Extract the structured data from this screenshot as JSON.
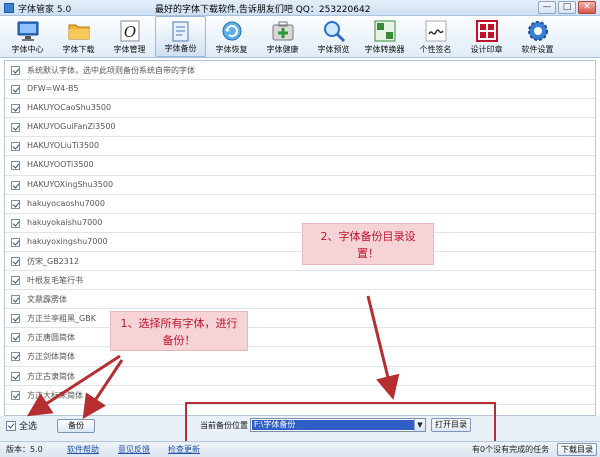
{
  "window": {
    "title": "字体管家 5.0",
    "slogan": "最好的字体下载软件,告诉朋友们吧 QQ：253220642",
    "min_label": "—",
    "max_label": "□",
    "close_label": "✕"
  },
  "toolbar": {
    "items": [
      {
        "label": "字体中心",
        "icon": "display-icon"
      },
      {
        "label": "字体下载",
        "icon": "folder-icon"
      },
      {
        "label": "字体管理",
        "icon": "font-o-icon"
      },
      {
        "label": "字体备份",
        "icon": "backup-icon"
      },
      {
        "label": "字体恢复",
        "icon": "restore-icon"
      },
      {
        "label": "字体健康",
        "icon": "health-icon"
      },
      {
        "label": "字体预览",
        "icon": "magnifier-icon"
      },
      {
        "label": "字体转换器",
        "icon": "converter-icon"
      },
      {
        "label": "个性签名",
        "icon": "signature-icon"
      },
      {
        "label": "设计印章",
        "icon": "seal-icon"
      },
      {
        "label": "软件设置",
        "icon": "gear-icon"
      }
    ],
    "active_index": 3
  },
  "font_list": [
    "系统默认字体，选中此项则备份系统自带的字体",
    "DFW=W4-B5",
    "HAKUYOCaoShu3500",
    "HAKUYOGuiFanZi3500",
    "HAKUYOLiuTi3500",
    "HAKUYOOTi3500",
    "HAKUYOXingShu3500",
    "hakuyocaoshu7000",
    "hakuyokaishu7000",
    "hakuyoxingshu7000",
    "仿宋_GB2312",
    "叶根友毛笔行书",
    "文鼎霹雳体",
    "方正兰亭粗黑_GBK",
    "方正唐圆简体",
    "方正剑体简体",
    "方正古隶简体",
    "方正大标宋简体"
  ],
  "annotations": {
    "step1": "1、选择所有字体，进行备份！",
    "step2": "2、字体备份目录设置！"
  },
  "controls": {
    "select_all_label": "全选",
    "backup_button": "备份",
    "location_label": "当前备份位置",
    "location_value": "F:\\字体备份",
    "open_dir_button": "打开目录",
    "dropdown_arrow": "▼"
  },
  "status": {
    "version": "版本：5.0",
    "help_link": "软件帮助",
    "feedback_link": "意见反馈",
    "update_link": "检查更新",
    "task_text": "有0个没有完成的任务",
    "download_dir_button": "下载目录"
  },
  "colors": {
    "accent_red": "#b72e30",
    "selection_blue": "#2f5fc4",
    "callout_bg": "#f6d3d6",
    "callout_text": "#c0132b"
  }
}
